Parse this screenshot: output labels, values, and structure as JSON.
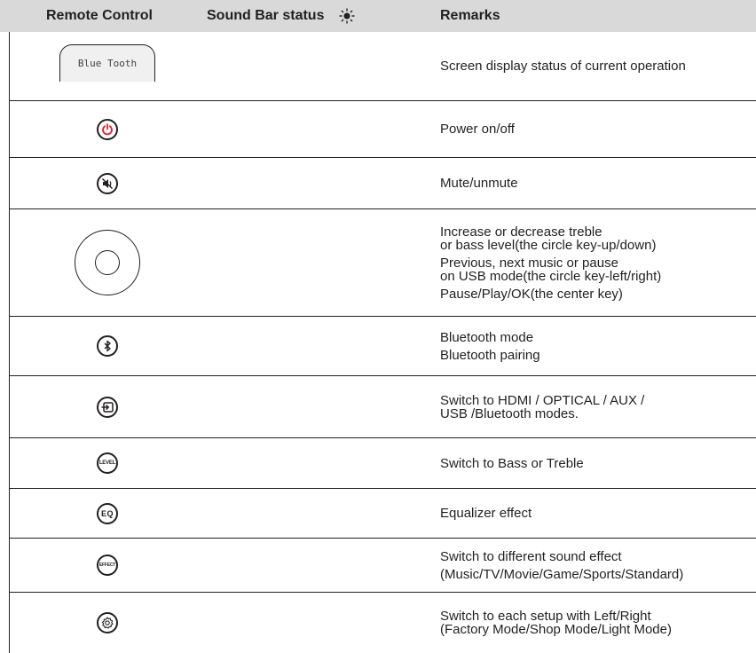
{
  "header": {
    "col1": "Remote Control",
    "col2": "Sound Bar status",
    "col3": "Remarks"
  },
  "rows": [
    {
      "button": "display",
      "display_text": "Blue Tooth",
      "remarks": [
        "Screen display status of current operation"
      ]
    },
    {
      "button": "power-icon",
      "remarks": [
        "Power on/off"
      ]
    },
    {
      "button": "mute-icon",
      "remarks": [
        "Mute/unmute"
      ]
    },
    {
      "button": "circle-key",
      "remarks": [
        "Increase or decrease treble",
        "or bass level(the circle key-up/down)",
        "Previous, next music or pause",
        "on USB mode(the circle key-left/right)",
        "Pause/Play/OK(the center key)"
      ]
    },
    {
      "button": "bluetooth-icon",
      "remarks": [
        "Bluetooth mode",
        "Bluetooth pairing"
      ]
    },
    {
      "button": "input-source-icon",
      "remarks": [
        "Switch to HDMI / OPTICAL / AUX /",
        "USB /Bluetooth modes."
      ]
    },
    {
      "button": "level-icon",
      "label": "LEVEL",
      "remarks": [
        "Switch to Bass or Treble"
      ]
    },
    {
      "button": "eq-icon",
      "label": "EQ",
      "remarks": [
        "Equalizer effect"
      ]
    },
    {
      "button": "effect-icon",
      "label": "EFFECT",
      "remarks": [
        "Switch to different sound effect",
        "(Music/TV/Movie/Game/Sports/Standard)"
      ]
    },
    {
      "button": "settings-icon",
      "remarks": [
        "Switch to each setup with Left/Right",
        "(Factory Mode/Shop Mode/Light Mode)"
      ]
    }
  ],
  "colors": {
    "header_bg": "#d9d9d9",
    "power_red": "#e5202e",
    "text": "#231f20"
  }
}
